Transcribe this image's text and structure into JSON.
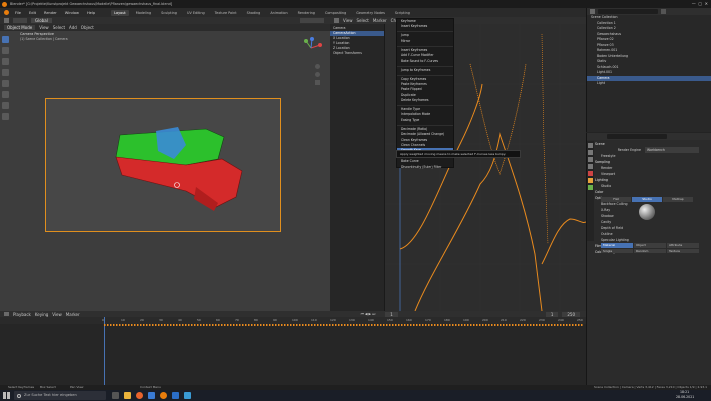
{
  "window_title": "Blender* [G:\\Projekte\\Kunstprojekt Gewaechshaus\\Modelle\\Pflanzen\\gewaechshaus_final.blend]",
  "menu": [
    "File",
    "Edit",
    "Render",
    "Window",
    "Help"
  ],
  "workspaces": [
    "Layout",
    "Modeling",
    "Sculpting",
    "UV Editing",
    "Texture Paint",
    "Shading",
    "Animation",
    "Rendering",
    "Compositing",
    "Geometry Nodes",
    "Scripting"
  ],
  "active_workspace": "Layout",
  "viewport": {
    "mode": "Object Mode",
    "menus": [
      "View",
      "Select",
      "Add",
      "Object"
    ],
    "shading": "Global",
    "overlay_title": "Camera Perspective",
    "overlay_sub": "(1) Szene Collection | Camera"
  },
  "graph_editor": {
    "menus": [
      "View",
      "Select",
      "Marker",
      "Channel",
      "Key"
    ],
    "normalize": "Normalize",
    "channels": [
      {
        "label": "Camera",
        "sel": false
      },
      {
        "label": "CameraAction",
        "sel": true
      },
      {
        "label": "X Location",
        "sel": false
      },
      {
        "label": "Y Location",
        "sel": false
      },
      {
        "label": "Z Location",
        "sel": false
      },
      {
        "label": "Object Transforms",
        "sel": false
      }
    ]
  },
  "key_menu": {
    "items": [
      {
        "label": "Keyframe",
        "sep": false,
        "hl": false
      },
      {
        "label": "Insert Keyframes",
        "sep": false,
        "hl": false
      },
      {
        "label": "",
        "sep": true,
        "hl": false
      },
      {
        "label": "Jump",
        "sep": false,
        "hl": false
      },
      {
        "label": "Mirror",
        "sep": false,
        "hl": false
      },
      {
        "label": "",
        "sep": true,
        "hl": false
      },
      {
        "label": "Insert Keyframes",
        "sep": false,
        "hl": false
      },
      {
        "label": "Add F-Curve Modifier",
        "sep": false,
        "hl": false
      },
      {
        "label": "Bake Sound to F-Curves",
        "sep": false,
        "hl": false
      },
      {
        "label": "",
        "sep": true,
        "hl": false
      },
      {
        "label": "Jump to Keyframes",
        "sep": false,
        "hl": false
      },
      {
        "label": "",
        "sep": true,
        "hl": false
      },
      {
        "label": "Copy Keyframes",
        "sep": false,
        "hl": false
      },
      {
        "label": "Paste Keyframes",
        "sep": false,
        "hl": false
      },
      {
        "label": "Paste Flipped",
        "sep": false,
        "hl": false
      },
      {
        "label": "Duplicate",
        "sep": false,
        "hl": false
      },
      {
        "label": "Delete Keyframes",
        "sep": false,
        "hl": false
      },
      {
        "label": "",
        "sep": true,
        "hl": false
      },
      {
        "label": "Handle Type",
        "sep": false,
        "hl": false
      },
      {
        "label": "Interpolation Mode",
        "sep": false,
        "hl": false
      },
      {
        "label": "Easing Type",
        "sep": false,
        "hl": false
      },
      {
        "label": "",
        "sep": true,
        "hl": false
      },
      {
        "label": "Decimate (Ratio)",
        "sep": false,
        "hl": false
      },
      {
        "label": "Decimate (Allowed Change)",
        "sep": false,
        "hl": false
      },
      {
        "label": "Clean Keyframes",
        "sep": false,
        "hl": false
      },
      {
        "label": "Clean Channels",
        "sep": false,
        "hl": false
      },
      {
        "label": "Smooth Keys",
        "sep": false,
        "hl": true
      },
      {
        "label": "Sample Keyframes",
        "sep": false,
        "hl": false
      },
      {
        "label": "Bake Curve",
        "sep": false,
        "hl": false
      },
      {
        "label": "Discontinuity (Euler) Filter",
        "sep": false,
        "hl": false
      }
    ],
    "tooltip": "Apply weighted moving means to make selected F-Curves less bumpy."
  },
  "outliner": {
    "search_placeholder": "",
    "title": "Scene Collection",
    "rows": [
      {
        "label": "Collection 1",
        "act": false
      },
      {
        "label": "Collection 2",
        "act": false
      },
      {
        "label": "Gewaechshaus",
        "act": false
      },
      {
        "label": "Pflanze 02",
        "act": false
      },
      {
        "label": "Pflanze 03",
        "act": false
      },
      {
        "label": "Rahmen.001",
        "act": false
      },
      {
        "label": "Boden Unterteilung",
        "act": false
      },
      {
        "label": "Stativ",
        "act": false
      },
      {
        "label": "Schlauch.001",
        "act": false
      },
      {
        "label": "Light.001",
        "act": false
      },
      {
        "label": "Camera",
        "act": true
      },
      {
        "label": "Light",
        "act": false
      }
    ]
  },
  "properties": {
    "scene": "Scene",
    "render_engine_label": "Render Engine",
    "render_engine": "Workbench",
    "rows": [
      {
        "label": "Freestyle",
        "head": false
      },
      {
        "label": "Sampling",
        "head": true
      },
      {
        "label": "Render",
        "head": false
      },
      {
        "label": "Viewport",
        "head": false
      },
      {
        "label": "Lighting",
        "head": true
      },
      {
        "label": "Studio",
        "head": false
      },
      {
        "label": "Color",
        "head": true
      },
      {
        "label": "Options",
        "head": true
      },
      {
        "label": "Backface Culling",
        "head": false
      },
      {
        "label": "X-Ray",
        "head": false
      },
      {
        "label": "Shadow",
        "head": false
      },
      {
        "label": "Cavity",
        "head": false
      },
      {
        "label": "Depth of Field",
        "head": false
      },
      {
        "label": "Outline",
        "head": false
      },
      {
        "label": "Specular Lighting",
        "head": false
      },
      {
        "label": "Film",
        "head": true
      },
      {
        "label": "Color Management",
        "head": true
      }
    ],
    "lighting_options": [
      "Flat",
      "Studio",
      "MatCap"
    ],
    "active_lighting": "Studio",
    "color_options": [
      "Material",
      "Object",
      "Attribute",
      "Single",
      "Random",
      "Texture"
    ],
    "active_color": "Material"
  },
  "timeline": {
    "menus": [
      "Playback",
      "Keying",
      "View",
      "Marker"
    ],
    "current_frame": "1",
    "start": "1",
    "end": "250",
    "ticks": [
      "0",
      "10",
      "20",
      "30",
      "40",
      "50",
      "60",
      "70",
      "80",
      "90",
      "100",
      "110",
      "120",
      "130",
      "140",
      "150",
      "160",
      "170",
      "180",
      "190",
      "200",
      "210",
      "220",
      "230",
      "240",
      "250"
    ]
  },
  "status": {
    "left": "Select Keyframes",
    "mid1": "Box Select",
    "mid2": "Pan View",
    "context": "Context Menu",
    "right": "Scene Collection | Camera | Verts 3,412 | Faces 3,210 | Objects 1/9 | 2.93.1"
  },
  "taskbar": {
    "search_placeholder": "Zur Suche Text hier eingeben",
    "time": "18:21",
    "date": "28.06.2021"
  },
  "colors": {
    "accent": "#e08f1e",
    "select": "#4772b3",
    "curve": "#e88a1e"
  }
}
